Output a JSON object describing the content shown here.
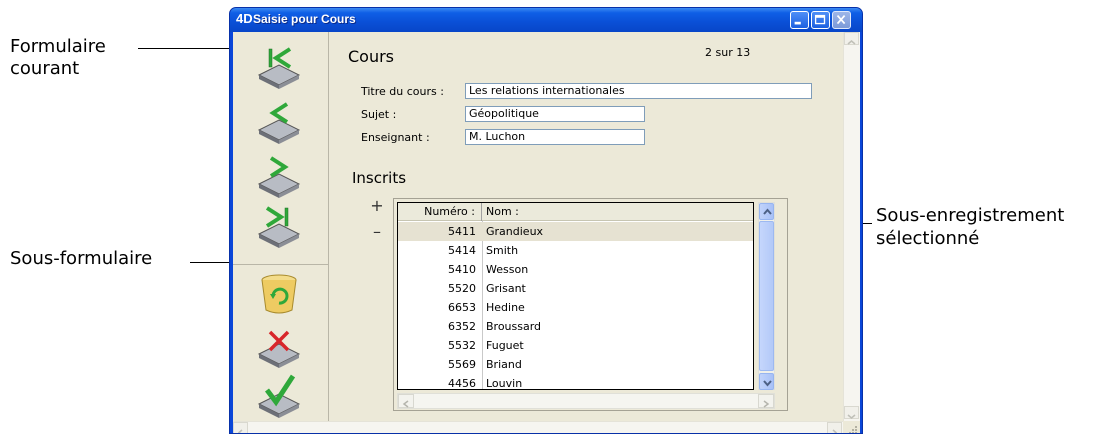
{
  "annotations": {
    "formulaire_courant_line1": "Formulaire",
    "formulaire_courant_line2": "courant",
    "sous_formulaire": "Sous-formulaire",
    "sous_enregistrement_line1": "Sous-enregistrement",
    "sous_enregistrement_line2": "sélectionné"
  },
  "window": {
    "logo": "4D",
    "title": "Saisie pour  Cours"
  },
  "toolbar": {
    "icons": [
      "first-record-icon",
      "previous-record-icon",
      "next-record-icon",
      "last-record-icon",
      "trash-icon",
      "delete-record-icon",
      "validate-icon"
    ]
  },
  "form": {
    "title": "Cours",
    "counter": "2 sur 13",
    "fields": {
      "titre_label": "Titre du cours :",
      "titre_value": "Les relations internationales",
      "sujet_label": "Sujet :",
      "sujet_value": "Géopolitique",
      "enseignant_label": "Enseignant :",
      "enseignant_value": "M. Luchon"
    },
    "subform": {
      "title": "Inscrits",
      "add": "+",
      "remove": "–",
      "headers": {
        "numero": "Numéro :",
        "nom": "Nom :"
      },
      "rows": [
        {
          "num": "5411",
          "name": "Grandieux",
          "selected": true
        },
        {
          "num": "5414",
          "name": "Smith"
        },
        {
          "num": "5410",
          "name": "Wesson"
        },
        {
          "num": "5520",
          "name": "Grisant"
        },
        {
          "num": "6653",
          "name": "Hedine"
        },
        {
          "num": "6352",
          "name": "Broussard"
        },
        {
          "num": "5532",
          "name": "Fuguet"
        },
        {
          "num": "5569",
          "name": "Briand"
        },
        {
          "num": "4456",
          "name": "Louvin"
        }
      ]
    }
  },
  "colors": {
    "titlebar": "#0a4fd6",
    "window_bg": "#ece9d8",
    "selection": "#e6e2d2",
    "icon_green": "#2fa83a",
    "icon_red": "#d8262a"
  }
}
